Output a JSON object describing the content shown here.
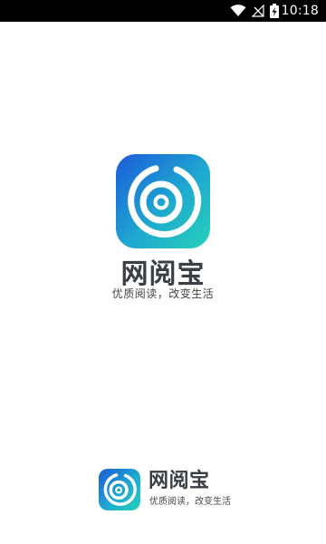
{
  "status_bar": {
    "time": "10:18",
    "icons": [
      "wifi-icon",
      "signal-off-icon",
      "battery-charging-icon"
    ],
    "background": "#000000"
  },
  "splash": {
    "app_name": "网阅宝",
    "slogan": "优质阅读，改变生活",
    "icon_gradient": [
      "#1a5fd6",
      "#22c7c0"
    ]
  },
  "footer": {
    "app_name": "网阅宝",
    "slogan": "优质阅读，改变生活"
  }
}
